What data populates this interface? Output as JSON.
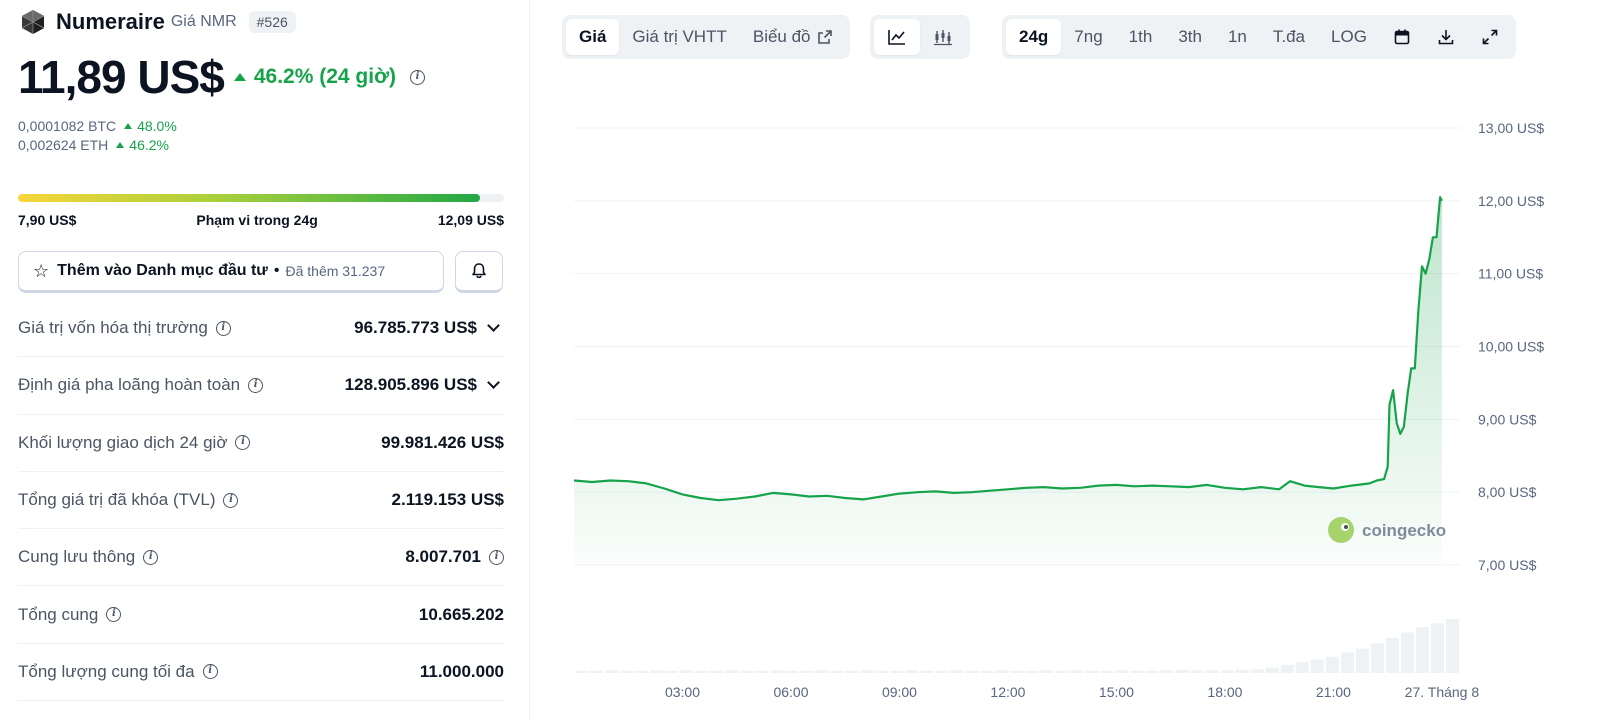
{
  "coin": {
    "name": "Numeraire",
    "subtitle": "Giá NMR",
    "rank": "#526",
    "logo_icon": "numeraire-logo-icon"
  },
  "price": {
    "value": "11,89 US$",
    "change": "46.2% (24 giờ)",
    "change_color": "#16a34a"
  },
  "conversions": [
    {
      "value": "0,0001082 BTC",
      "change": "48.0%"
    },
    {
      "value": "0,002624 ETH",
      "change": "46.2%"
    }
  ],
  "range": {
    "low": "7,90 US$",
    "label": "Phạm vi trong 24g",
    "high": "12,09 US$",
    "position": 0.95
  },
  "watchlist": {
    "label": "Thêm vào Danh mục đầu tư",
    "separator": "•",
    "added": "Đã thêm 31.237"
  },
  "stats": [
    {
      "label": "Giá trị vốn hóa thị trường",
      "value": "96.785.773 US$"
    },
    {
      "label": "Định giá pha loãng hoàn toàn",
      "value": "128.905.896 US$"
    },
    {
      "label": "Khối lượng giao dịch 24 giờ",
      "value": "99.981.426 US$"
    },
    {
      "label": "Tổng giá trị đã khóa (TVL)",
      "value": "2.119.153 US$"
    },
    {
      "label": "Cung lưu thông",
      "value": "8.007.701"
    },
    {
      "label": "Tổng cung",
      "value": "10.665.202"
    },
    {
      "label": "Tổng lượng cung tối đa",
      "value": "11.000.000"
    }
  ],
  "toolbar": {
    "view_tabs": [
      "Giá",
      "Giá trị VHTT",
      "Biểu đồ"
    ],
    "chart_type_icons": [
      "line-chart-icon",
      "candlestick-chart-icon"
    ],
    "range_tabs": [
      "24g",
      "7ng",
      "1th",
      "3th",
      "1n",
      "T.đa",
      "LOG"
    ],
    "action_icons": [
      "calendar-icon",
      "download-icon",
      "fullscreen-icon"
    ]
  },
  "chart_data": {
    "type": "area",
    "ylim": [
      7,
      13
    ],
    "yticks": [
      "13,00 US$",
      "12,00 US$",
      "11,00 US$",
      "10,00 US$",
      "9,00 US$",
      "8,00 US$",
      "7,00 US$"
    ],
    "xlim": [
      0,
      24.5
    ],
    "xticks": [
      {
        "t": 3,
        "label": "03:00"
      },
      {
        "t": 6,
        "label": "06:00"
      },
      {
        "t": 9,
        "label": "09:00"
      },
      {
        "t": 12,
        "label": "12:00"
      },
      {
        "t": 15,
        "label": "15:00"
      },
      {
        "t": 18,
        "label": "18:00"
      },
      {
        "t": 21,
        "label": "21:00"
      },
      {
        "t": 24,
        "label": "27. Tháng 8"
      }
    ],
    "x": [
      0.0,
      0.5,
      1.0,
      1.5,
      2.0,
      2.5,
      3.0,
      3.5,
      4.0,
      4.5,
      5.0,
      5.5,
      6.0,
      6.5,
      7.0,
      7.5,
      8.0,
      8.5,
      9.0,
      9.5,
      10.0,
      10.5,
      11.0,
      11.5,
      12.0,
      12.5,
      13.0,
      13.5,
      14.0,
      14.5,
      15.0,
      15.5,
      16.0,
      16.5,
      17.0,
      17.5,
      18.0,
      18.5,
      19.0,
      19.5,
      19.8,
      20.2,
      20.6,
      21.0,
      21.5,
      22.0,
      22.2,
      22.4,
      22.5,
      22.55,
      22.65,
      22.75,
      22.85,
      22.95,
      23.05,
      23.15,
      23.25,
      23.35,
      23.45,
      23.55,
      23.65,
      23.75,
      23.85,
      23.95,
      24.0
    ],
    "y": [
      8.16,
      8.14,
      8.16,
      8.15,
      8.12,
      8.05,
      7.97,
      7.92,
      7.89,
      7.91,
      7.94,
      7.99,
      7.97,
      7.94,
      7.95,
      7.92,
      7.9,
      7.94,
      7.98,
      8.0,
      8.01,
      7.99,
      8.0,
      8.02,
      8.04,
      8.06,
      8.07,
      8.05,
      8.06,
      8.09,
      8.1,
      8.08,
      8.09,
      8.08,
      8.07,
      8.1,
      8.06,
      8.04,
      8.07,
      8.04,
      8.15,
      8.09,
      8.07,
      8.05,
      8.09,
      8.12,
      8.16,
      8.18,
      8.35,
      9.2,
      9.4,
      8.95,
      8.8,
      8.9,
      9.35,
      9.7,
      9.7,
      10.5,
      11.1,
      11.0,
      11.2,
      11.5,
      11.5,
      12.05,
      12.0
    ],
    "volume": [
      0.04,
      0.04,
      0.05,
      0.04,
      0.04,
      0.05,
      0.04,
      0.05,
      0.04,
      0.04,
      0.05,
      0.04,
      0.04,
      0.05,
      0.04,
      0.04,
      0.05,
      0.04,
      0.04,
      0.05,
      0.04,
      0.04,
      0.05,
      0.04,
      0.04,
      0.05,
      0.04,
      0.04,
      0.05,
      0.04,
      0.04,
      0.05,
      0.04,
      0.05,
      0.04,
      0.04,
      0.05,
      0.04,
      0.04,
      0.05,
      0.06,
      0.05,
      0.05,
      0.05,
      0.06,
      0.07,
      0.1,
      0.15,
      0.2,
      0.25,
      0.3,
      0.38,
      0.45,
      0.55,
      0.65,
      0.75,
      0.85,
      0.92,
      1.0
    ],
    "line_color": "#16a34a",
    "watermark": "coingecko",
    "grid": true
  }
}
